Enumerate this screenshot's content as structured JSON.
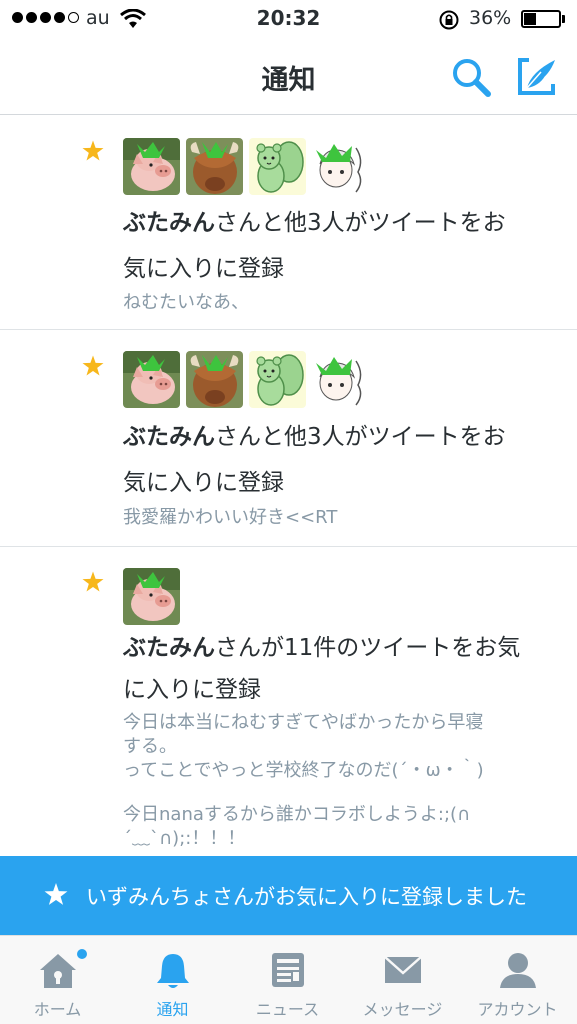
{
  "status_bar": {
    "carrier": "au",
    "time": "20:32",
    "battery_percent": "36%",
    "battery_level": 0.36,
    "signal_bars_filled": 4,
    "signal_bars_total": 5
  },
  "nav": {
    "title": "通知",
    "search_icon": "search-icon",
    "compose_icon": "compose-icon"
  },
  "colors": {
    "accent": "#2aa3ef",
    "star": "#f7b71c",
    "text": "#292f33",
    "muted": "#8899a6"
  },
  "notifications": [
    {
      "name": "ぶたみん",
      "line1_rest": "さんと他3人がツイートをお",
      "line2": "気に入りに登録",
      "preview": "ねむたいなあ、",
      "avatars": [
        "piggy-avatar",
        "highland-cow-avatar",
        "squirrel-avatar",
        "anime-girl-avatar"
      ]
    },
    {
      "name": "ぶたみん",
      "line1_rest": "さんと他3人がツイートをお",
      "line2": "気に入りに登録",
      "preview": "我愛羅かわいい好き<<RT",
      "avatars": [
        "piggy-avatar",
        "highland-cow-avatar",
        "squirrel-avatar",
        "anime-girl-avatar"
      ]
    },
    {
      "name": "ぶたみん",
      "line1_rest": "さんが11件のツイートをお気",
      "line2": "に入りに登録",
      "preview_lines": [
        "今日は本当にねむすぎてやばかったから早寝",
        "する。",
        "ってことでやっと学校終了なのだ(´・ω・｀)",
        "今日nanaするから誰かコラボしようよ:;(∩",
        "´﹏`∩);:！！！"
      ],
      "avatars": [
        "piggy-avatar"
      ]
    }
  ],
  "toast": {
    "text": "いずみんちょさんがお気に入りに登録しました"
  },
  "tabs": [
    {
      "label": "ホーム",
      "icon": "home-icon",
      "active": false,
      "has_dot": true
    },
    {
      "label": "通知",
      "icon": "bell-icon",
      "active": true,
      "has_dot": false
    },
    {
      "label": "ニュース",
      "icon": "news-icon",
      "active": false,
      "has_dot": false
    },
    {
      "label": "メッセージ",
      "icon": "envelope-icon",
      "active": false,
      "has_dot": false
    },
    {
      "label": "アカウント",
      "icon": "person-icon",
      "active": false,
      "has_dot": false
    }
  ]
}
